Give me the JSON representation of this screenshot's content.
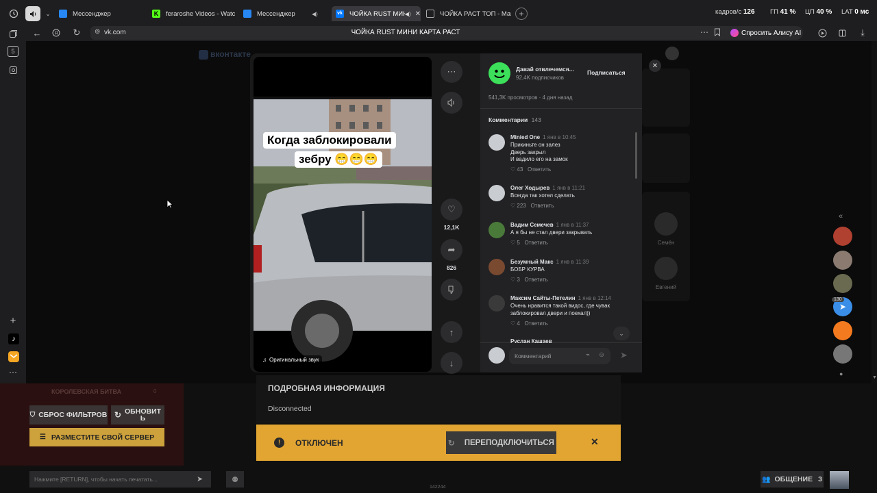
{
  "tabs": [
    {
      "label": "Мессенджер",
      "icon": "messenger-icon",
      "color": "#2787f5"
    },
    {
      "label": "feraroshe Videos - Watch C",
      "icon": "kick-icon",
      "color": "#53fc18"
    },
    {
      "label": "Мессенджер",
      "icon": "vk-messenger-icon",
      "color": "#2787f5"
    },
    {
      "label": "ЧОЙКА RUST МИНИ",
      "icon": "vk-icon",
      "color": "#0077ff"
    },
    {
      "label": "ЧОЙКА РАСТ ТОП - Marat",
      "icon": "page-icon",
      "color": "#888888"
    }
  ],
  "overlay_stats": {
    "fps_label": "кадров/с",
    "fps_value": "126",
    "gpu_label": "ГП",
    "gpu_value": "41 %",
    "cpu_label": "ЦП",
    "cpu_value": "40 %",
    "lat_label": "LAT",
    "lat_value": "0 мс"
  },
  "address": {
    "url": "vk.com",
    "page_title": "ЧОЙКА RUST МИНИ КАРТА РАСТ",
    "alice_label": "Спросить Алису AI"
  },
  "vk_bg": {
    "logo": "вконтакте"
  },
  "video": {
    "caption_line1": "Когда заблокировали",
    "caption_line2": "зебру 😁😁😁",
    "sound_label": "Оригинальный звук",
    "likes": "12,1K",
    "shares": "826"
  },
  "author": {
    "name": "Давай отвлечемся...",
    "subscribers": "92,4K подписчиков",
    "subscribe_label": "Подписаться",
    "views": "541,3K просмотров · 4 дня назад"
  },
  "comments_header": {
    "label": "Комментарии",
    "count": "143"
  },
  "comments": [
    {
      "name": "Minied One",
      "date": "1 янв в 10:45",
      "text": "Прикиньте он залез\nДверь закрыл\nИ вадило его на замок",
      "likes": "43",
      "reply": "Ответить"
    },
    {
      "name": "Олег Ходырев",
      "date": "1 янв в 11:21",
      "text": "Всегда так хотел сделать",
      "likes": "223",
      "reply": "Ответить"
    },
    {
      "name": "Вадим Семечев",
      "date": "1 янв в 11:37",
      "text": "А я бы не стал двери закрывать",
      "likes": "5",
      "reply": "Ответить"
    },
    {
      "name": "Безумный Макс",
      "date": "1 янв в 11:39",
      "text": "БОБР КУРВА",
      "likes": "3",
      "reply": "Ответить"
    },
    {
      "name": "Максим Сайты-Петелин",
      "date": "1 янв в 12:14",
      "text": "Очень нравится такой видос, где чувак\nзаблокировал двери и поехал))",
      "likes": "4",
      "reply": "Ответить"
    }
  ],
  "partial_comment_name": "Руслан Кашаев",
  "comment_input": {
    "placeholder": "Комментарий"
  },
  "friends": [
    {
      "name": "Семён"
    },
    {
      "name": "Евгений"
    }
  ],
  "game": {
    "royal_battle": "КОРОЛЕВСКАЯ БИТВА",
    "royal_count": "0",
    "reset_filters": "СБРОС ФИЛЬТРОВ",
    "refresh": "ОБНОВИТ\nЬ",
    "place_server": "РАЗМЕСТИТЕ СВОЙ СЕРВЕР",
    "details_title": "ПОДРОБНАЯ ИНФОРМАЦИЯ",
    "details_status": "Disconnected",
    "disconnected_label": "ОТКЛЮЧЕН",
    "reconnect_label": "ПЕРЕПОДКЛЮЧИТЬСЯ",
    "chat_placeholder": "Нажмите [RETURN], чтобы начать печатать...",
    "social_label": "ОБЩЕНИЕ",
    "social_count": "3",
    "build_number": "142244"
  },
  "side_badge": "130",
  "colors": {
    "accent_vk": "#0077ff",
    "game_yellow": "#e2a532",
    "game_orange": "#cda23c",
    "dark_red": "#2a1010"
  }
}
